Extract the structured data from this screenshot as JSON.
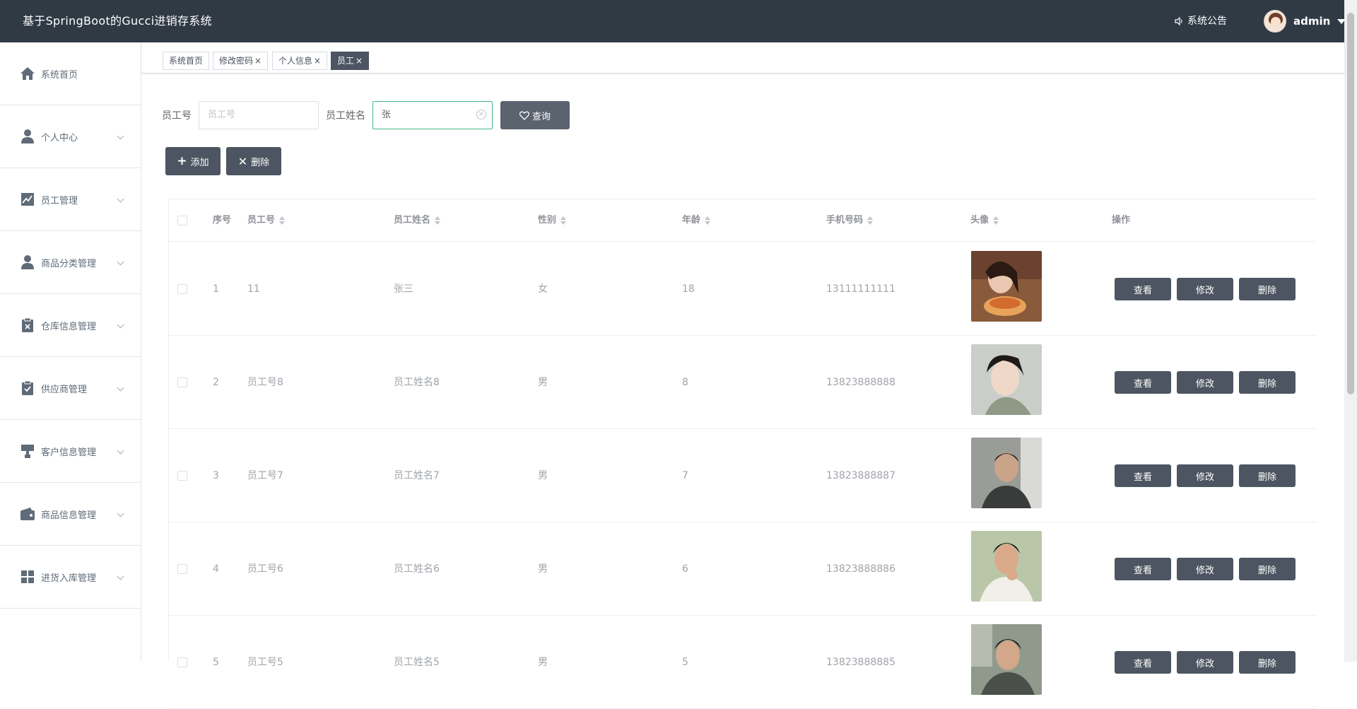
{
  "header": {
    "title": "基于SpringBoot的Gucci进销存系统",
    "notice": "系统公告",
    "user": "admin"
  },
  "sidebar": {
    "items": [
      {
        "label": "系统首页",
        "icon": "home-icon"
      },
      {
        "label": "个人中心",
        "icon": "person-icon"
      },
      {
        "label": "员工管理",
        "icon": "chart-icon"
      },
      {
        "label": "商品分类管理",
        "icon": "person-icon"
      },
      {
        "label": "仓库信息管理",
        "icon": "clipboard-x-icon"
      },
      {
        "label": "供应商管理",
        "icon": "clipboard-check-icon"
      },
      {
        "label": "客户信息管理",
        "icon": "stamp-icon"
      },
      {
        "label": "商品信息管理",
        "icon": "wallet-icon"
      },
      {
        "label": "进货入库管理",
        "icon": "grid-icon"
      }
    ]
  },
  "tabs": [
    {
      "label": "系统首页",
      "closable": false
    },
    {
      "label": "修改密码",
      "closable": true
    },
    {
      "label": "个人信息",
      "closable": true
    },
    {
      "label": "员工",
      "closable": true,
      "active": true
    }
  ],
  "search": {
    "id_label": "员工号",
    "id_placeholder": "员工号",
    "id_value": "",
    "name_label": "员工姓名",
    "name_value": "张",
    "query_label": "查询"
  },
  "toolbar": {
    "add_label": "添加",
    "delete_label": "删除"
  },
  "table": {
    "headers": {
      "index": "序号",
      "emp_id": "员工号",
      "emp_name": "员工姓名",
      "gender": "性别",
      "age": "年龄",
      "phone": "手机号码",
      "photo": "头像",
      "actions": "操作"
    },
    "rows": [
      {
        "index": "1",
        "emp_id": "11",
        "emp_name": "张三",
        "gender": "女",
        "age": "18",
        "phone": "13111111111"
      },
      {
        "index": "2",
        "emp_id": "员工号8",
        "emp_name": "员工姓名8",
        "gender": "男",
        "age": "8",
        "phone": "13823888888"
      },
      {
        "index": "3",
        "emp_id": "员工号7",
        "emp_name": "员工姓名7",
        "gender": "男",
        "age": "7",
        "phone": "13823888887"
      },
      {
        "index": "4",
        "emp_id": "员工号6",
        "emp_name": "员工姓名6",
        "gender": "男",
        "age": "6",
        "phone": "13823888886"
      },
      {
        "index": "5",
        "emp_id": "员工号5",
        "emp_name": "员工姓名5",
        "gender": "男",
        "age": "5",
        "phone": "13823888885"
      }
    ],
    "action_labels": {
      "view": "查看",
      "edit": "修改",
      "delete": "删除"
    }
  },
  "colors": {
    "topbar": "#2f3a45",
    "button": "#4c5561",
    "focus": "#42b983"
  }
}
